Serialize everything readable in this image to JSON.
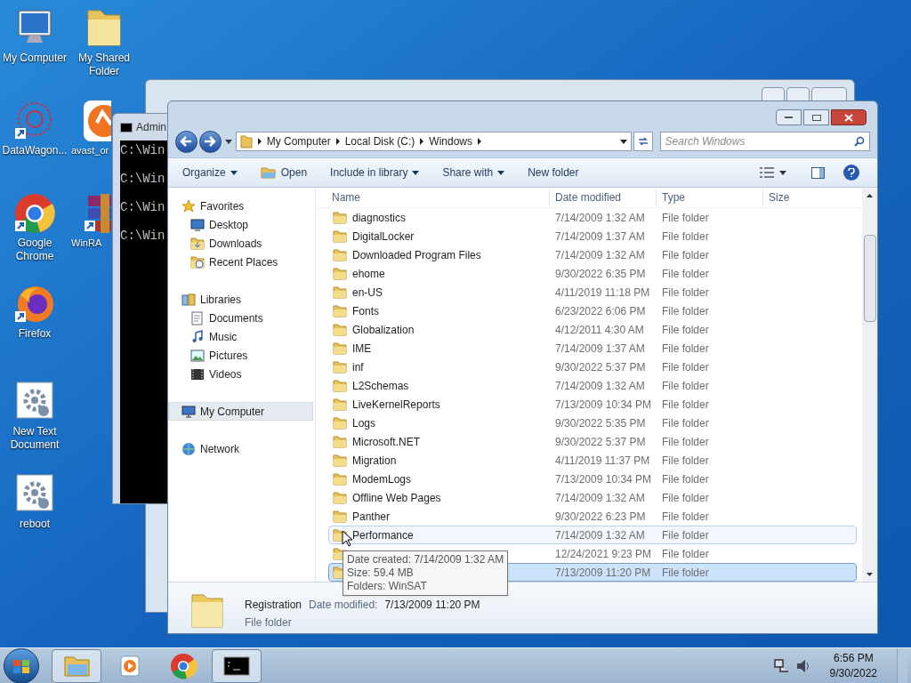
{
  "desktop_icons": [
    {
      "label": "My Computer",
      "kind": "computer"
    },
    {
      "label": "My Shared Folder",
      "kind": "folder"
    },
    {
      "label": "DataWagon...",
      "kind": "datawagon"
    },
    {
      "label": "avast_or",
      "kind": "avast"
    },
    {
      "label": "Google Chrome",
      "kind": "chrome"
    },
    {
      "label": "WinRA",
      "kind": "winrar"
    },
    {
      "label": "Firefox",
      "kind": "firefox"
    },
    {
      "label": "New Text Document",
      "kind": "gear"
    },
    {
      "label": "reboot",
      "kind": "gear"
    }
  ],
  "console_window": {
    "title": "Admin",
    "lines": [
      "C:\\Win",
      "C:\\Win",
      "C:\\Win",
      "C:\\Win"
    ]
  },
  "explorer": {
    "breadcrumb": [
      "My Computer",
      "Local Disk (C:)",
      "Windows"
    ],
    "search": {
      "placeholder": "Search Windows"
    },
    "toolbar": [
      {
        "label": "Organize",
        "dropdown": true,
        "icon": false
      },
      {
        "label": "Open",
        "dropdown": false,
        "icon": true
      },
      {
        "label": "Include in library",
        "dropdown": true,
        "icon": false
      },
      {
        "label": "Share with",
        "dropdown": true,
        "icon": false
      },
      {
        "label": "New folder",
        "dropdown": false,
        "icon": false
      }
    ],
    "nav": [
      {
        "label": "Favorites",
        "kind": "star",
        "selected": false,
        "children": [
          {
            "label": "Desktop",
            "kind": "desktop",
            "selected": false
          },
          {
            "label": "Downloads",
            "kind": "downloads",
            "selected": false
          },
          {
            "label": "Recent Places",
            "kind": "recent",
            "selected": false
          }
        ]
      },
      {
        "label": "Libraries",
        "kind": "library",
        "selected": false,
        "children": [
          {
            "label": "Documents",
            "kind": "documents",
            "selected": false
          },
          {
            "label": "Music",
            "kind": "music",
            "selected": false
          },
          {
            "label": "Pictures",
            "kind": "pictures",
            "selected": false
          },
          {
            "label": "Videos",
            "kind": "videos",
            "selected": false
          }
        ]
      },
      {
        "label": "My Computer",
        "kind": "computer",
        "selected": true
      },
      {
        "label": "Network",
        "kind": "network",
        "selected": false
      }
    ],
    "columns": [
      "Name",
      "Date modified",
      "Type",
      "Size"
    ],
    "rows": [
      {
        "name": "diagnostics",
        "date": "7/14/2009 1:32 AM",
        "type": "File folder",
        "selected": false,
        "hovered": false
      },
      {
        "name": "DigitalLocker",
        "date": "7/14/2009 1:37 AM",
        "type": "File folder",
        "selected": false,
        "hovered": false
      },
      {
        "name": "Downloaded Program Files",
        "date": "7/14/2009 1:32 AM",
        "type": "File folder",
        "selected": false,
        "hovered": false
      },
      {
        "name": "ehome",
        "date": "9/30/2022 6:35 PM",
        "type": "File folder",
        "selected": false,
        "hovered": false
      },
      {
        "name": "en-US",
        "date": "4/11/2019 11:18 PM",
        "type": "File folder",
        "selected": false,
        "hovered": false
      },
      {
        "name": "Fonts",
        "date": "6/23/2022 6:06 PM",
        "type": "File folder",
        "selected": false,
        "hovered": false
      },
      {
        "name": "Globalization",
        "date": "4/12/2011 4:30 AM",
        "type": "File folder",
        "selected": false,
        "hovered": false
      },
      {
        "name": "IME",
        "date": "7/14/2009 1:37 AM",
        "type": "File folder",
        "selected": false,
        "hovered": false
      },
      {
        "name": "inf",
        "date": "9/30/2022 5:37 PM",
        "type": "File folder",
        "selected": false,
        "hovered": false
      },
      {
        "name": "L2Schemas",
        "date": "7/14/2009 1:32 AM",
        "type": "File folder",
        "selected": false,
        "hovered": false
      },
      {
        "name": "LiveKernelReports",
        "date": "7/13/2009 10:34 PM",
        "type": "File folder",
        "selected": false,
        "hovered": false
      },
      {
        "name": "Logs",
        "date": "9/30/2022 5:35 PM",
        "type": "File folder",
        "selected": false,
        "hovered": false
      },
      {
        "name": "Microsoft.NET",
        "date": "9/30/2022 5:37 PM",
        "type": "File folder",
        "selected": false,
        "hovered": false
      },
      {
        "name": "Migration",
        "date": "4/11/2019 11:37 PM",
        "type": "File folder",
        "selected": false,
        "hovered": false
      },
      {
        "name": "ModemLogs",
        "date": "7/13/2009 10:34 PM",
        "type": "File folder",
        "selected": false,
        "hovered": false
      },
      {
        "name": "Offline Web Pages",
        "date": "7/14/2009 1:32 AM",
        "type": "File folder",
        "selected": false,
        "hovered": false
      },
      {
        "name": "Panther",
        "date": "9/30/2022 6:23 PM",
        "type": "File folder",
        "selected": false,
        "hovered": false
      },
      {
        "name": "Performance",
        "date": "7/14/2009 1:32 AM",
        "type": "File folder",
        "selected": false,
        "hovered": true
      },
      {
        "date": "12/24/2021 9:23 PM",
        "type": "File folder",
        "selected": false,
        "hovered": false
      },
      {
        "date": "7/13/2009 11:20 PM",
        "type": "File folder",
        "selected": true,
        "hovered": false
      }
    ],
    "tooltip": [
      "Date created: 7/14/2009 1:32 AM",
      "Size: 59.4 MB",
      "Folders: WinSAT"
    ],
    "details": {
      "name": "Registration",
      "date_label": "Date modified:",
      "date": "7/13/2009 11:20 PM",
      "type": "File folder"
    }
  },
  "taskbar": {
    "items": [
      {
        "kind": "explorer",
        "active": true
      },
      {
        "kind": "media",
        "active": false
      },
      {
        "kind": "chrome",
        "active": false
      },
      {
        "kind": "console",
        "active": true
      }
    ],
    "time": "6:56 PM",
    "date": "9/30/2022"
  }
}
